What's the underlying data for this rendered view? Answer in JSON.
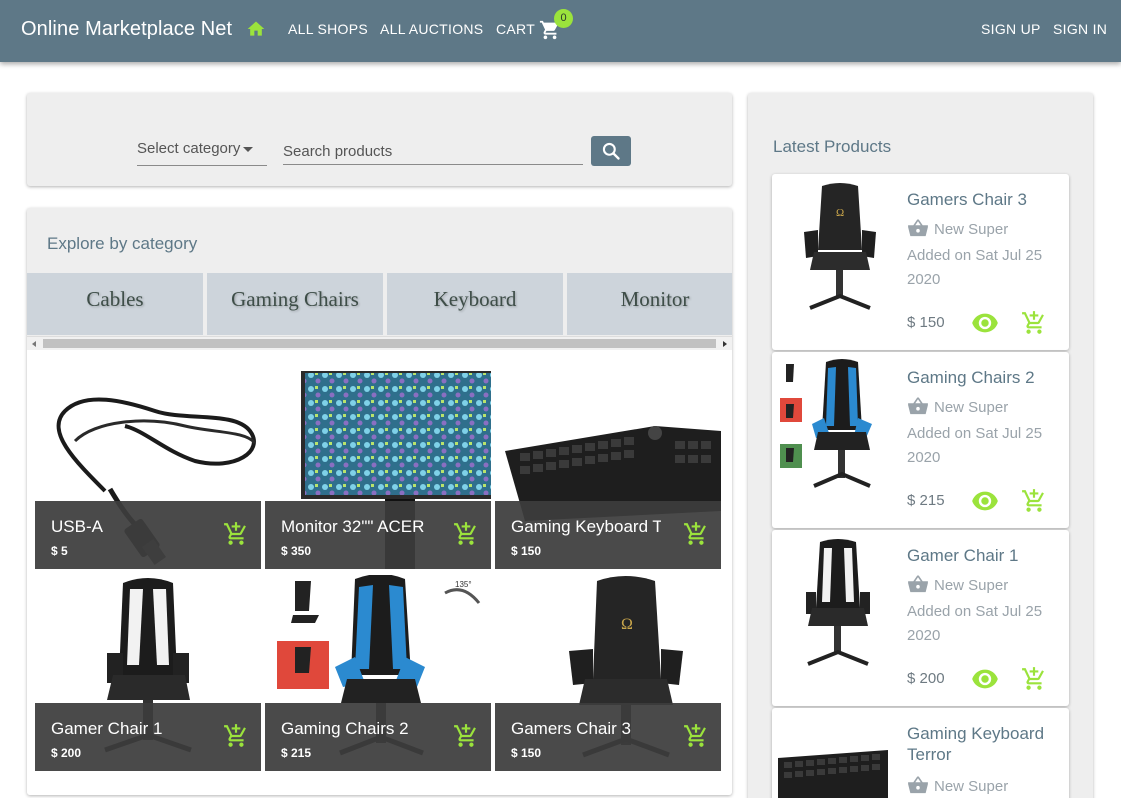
{
  "header": {
    "brand": "Online Marketplace Net",
    "nav": [
      "ALL SHOPS",
      "ALL AUCTIONS",
      "CART"
    ],
    "cart_count": "0",
    "auth": [
      "SIGN UP",
      "SIGN IN"
    ],
    "bar_color": "#5e7887",
    "accent_color": "#9be33c"
  },
  "search": {
    "category_label": "Select category",
    "placeholder": "Search products",
    "button_icon": "search-icon"
  },
  "explore": {
    "title": "Explore by category",
    "categories": [
      "Cables",
      "Gaming Chairs",
      "Keyboard",
      "Monitor"
    ]
  },
  "products": [
    {
      "name": "USB-A",
      "price": "$ 5",
      "image": "usb-cable"
    },
    {
      "name": "Monitor 32\"\" ACER",
      "price": "$ 350",
      "image": "monitor"
    },
    {
      "name": "Gaming Keyboard Terror",
      "price": "$ 150",
      "image": "keyboard"
    },
    {
      "name": "Gamer Chair 1",
      "price": "$ 200",
      "image": "white-chair"
    },
    {
      "name": "Gaming Chairs 2",
      "price": "$ 215",
      "image": "blue-chair"
    },
    {
      "name": "Gamers Chair 3",
      "price": "$ 150",
      "image": "black-chair"
    }
  ],
  "latest": {
    "title": "Latest Products",
    "items": [
      {
        "name": "Gamers Chair 3",
        "shop": "New Super",
        "date": "Added on Sat Jul 25 2020",
        "price": "$ 150"
      },
      {
        "name": "Gaming Chairs 2",
        "shop": "New Super",
        "date": "Added on Sat Jul 25 2020",
        "price": "$ 215"
      },
      {
        "name": "Gamer Chair 1",
        "shop": "New Super",
        "date": "Added on Sat Jul 25 2020",
        "price": "$ 200"
      },
      {
        "name": "Gaming Keyboard Terror",
        "shop": "New Super",
        "date": "",
        "price": ""
      }
    ]
  }
}
